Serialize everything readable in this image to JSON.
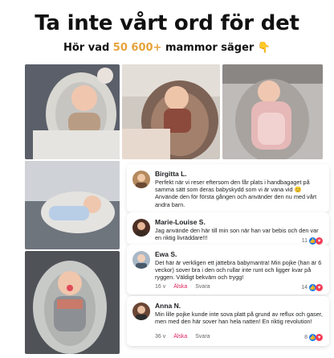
{
  "header": {
    "title": "Ta inte vårt ord för det",
    "subtitle_prefix": "Hör vad ",
    "subtitle_highlight": "50 600+",
    "subtitle_suffix": " mammor säger ",
    "subtitle_emoji": "👇"
  },
  "colors": {
    "highlight": "#e6a33a",
    "like_blue": "#1877f2",
    "heart_red": "#f33e58"
  },
  "photos": [
    {
      "icon": "baby-sleeping-photo"
    },
    {
      "icon": "baby-in-nest-photo"
    },
    {
      "icon": "baby-pink-outfit-photo"
    },
    {
      "icon": "baby-lying-photo"
    },
    {
      "icon": "baby-pacifier-photo"
    }
  ],
  "comments": [
    {
      "name": "Birgitta L.",
      "text": "Perfekt när vi reser eftersom den får plats i handbagaget på samma sätt som deras babyskydd som vi är vana vid 😊 Använde den för första gången och använder den nu med vårt andra barn.",
      "reactions": ""
    },
    {
      "name": "Marie-Louise S.",
      "text": "Jag använde den här till min son när han var bebis och den var en riktig livräddare!!!",
      "reactions": "11"
    },
    {
      "name": "Ewa S.",
      "text": "Det här är verkligen ett jättebra babymantra! Min pojke (han är 6 veckor) sover bra i den och rullar inte runt och ligger kvar på ryggen. Väldigt bekväm och trygg!",
      "time": "16 v",
      "like": "Älska",
      "reply": "Svara",
      "reactions": "14"
    },
    {
      "name": "Anna N.",
      "text": "Min lille pojke kunde inte sova platt på grund av reflux och gaser, men med den här sover han hela natten! En riktig revolution!",
      "time": "36 v",
      "like": "Älska",
      "reply": "Svara",
      "reactions": "8"
    }
  ]
}
